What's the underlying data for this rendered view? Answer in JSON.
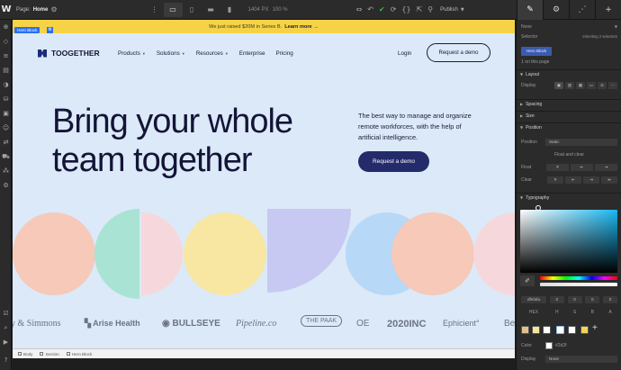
{
  "topbar": {
    "page_prefix": "Page:",
    "page_name": "Home",
    "canvas_width": "1404 PX",
    "zoom": "100 %",
    "publish_label": "Publish"
  },
  "banner": {
    "text": "We just raised $20M in Series B.",
    "link": "Learn more →"
  },
  "selection": {
    "label": "Hero Block"
  },
  "site": {
    "brand": "TOOGETHER",
    "menu": [
      "Products",
      "Solutions",
      "Resources",
      "Enterprise",
      "Pricing"
    ],
    "login": "Login",
    "nav_cta": "Request a demo",
    "hero_title_line1": "Bring your whole",
    "hero_title_line2": "team together",
    "hero_sub": "The best way to manage and organize remote workforces, with the help of artificial intelligence.",
    "hero_cta": "Request a demo",
    "shape_colors": [
      "#f6c9b8",
      "#a8e3d3",
      "#f6d8dc",
      "#f7e7a3",
      "#c7c9f2",
      "#b7d8f7",
      "#f6c9b8",
      "#f6d8dc"
    ],
    "logos": [
      "y & Simmons",
      "Arise Health",
      "BULLSEYE",
      "Pipeline.co",
      "THE PAAK",
      "OE",
      "2020INC",
      "Ephicient°",
      "Be"
    ]
  },
  "breadcrumb": [
    "Body",
    "Section",
    "Hero Block"
  ],
  "panel": {
    "state": "None",
    "selector_label": "Selector",
    "inheriting": "Inheriting 2 selectors",
    "selector_chip": "Hero Block",
    "selector_note": "1 on this page",
    "sections": [
      "Layout",
      "Spacing",
      "Size",
      "Position",
      "Typography"
    ],
    "display_label": "Display",
    "position_label": "Position",
    "position_value": "Static",
    "float_label": "Float and clear",
    "float_value": "None",
    "clear_label": "Clear",
    "hex_label": "HEX",
    "hex_value": "dfefafa",
    "channels": [
      "H",
      "S",
      "B",
      "A"
    ],
    "channel_values": [
      "0",
      "0",
      "0",
      "0"
    ],
    "color_label": "Color",
    "color_value": "#2d2f",
    "display2_label": "Display",
    "display2_value": "None",
    "swatch_colors": [
      "#e3c08a",
      "#f5e6a0",
      "#ffffff",
      "#f2d45c",
      "#8ab6f2"
    ],
    "accent": "#3b5bb0"
  }
}
